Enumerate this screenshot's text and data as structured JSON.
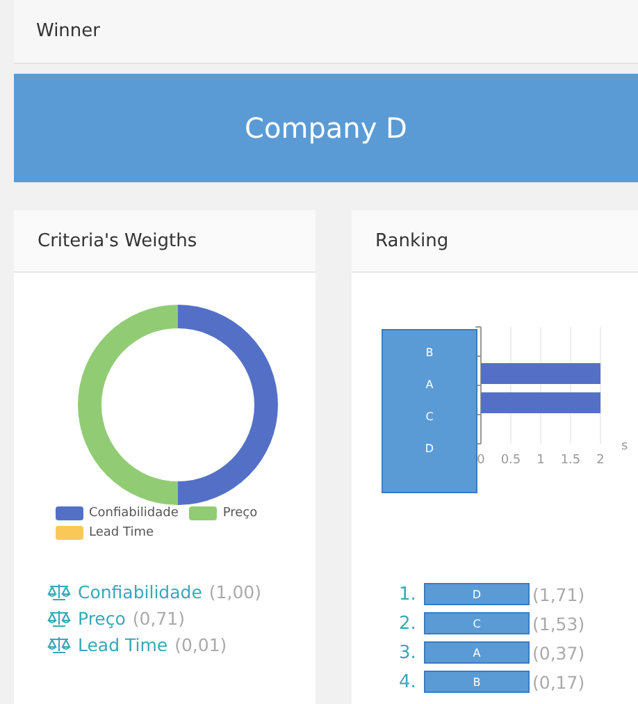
{
  "winner": {
    "title": "Winner",
    "company": "Company D"
  },
  "criteria": {
    "title": "Criteria's Weigths",
    "chart_data": {
      "type": "donut",
      "categories": [
        "Confiabilidade",
        "Preço",
        "Lead Time"
      ],
      "values": [
        0.5,
        0.5,
        0
      ]
    },
    "legend": [
      {
        "color": "#5470c6"
      },
      {
        "color": "#91cc75"
      },
      {
        "color": "#fac858"
      }
    ],
    "items": [
      {
        "name": "Confiabilidade",
        "value": "(1,00)"
      },
      {
        "name": "Preço",
        "value": "(0,71)"
      },
      {
        "name": "Lead Time",
        "value": "(0,01)"
      }
    ]
  },
  "ranking": {
    "title": "Ranking",
    "chart_data": {
      "type": "bar",
      "orientation": "horizontal",
      "categories": [
        "B",
        "A",
        "C",
        "D"
      ],
      "xlabel": "s",
      "xticks": [
        0,
        0.5,
        1,
        1.5,
        2
      ],
      "xlim": [
        0,
        2
      ],
      "grid": true,
      "series": [
        {
          "color": "#5470c6",
          "values": [
            null,
            2,
            2,
            null
          ]
        }
      ]
    },
    "items": [
      {
        "rank": "1.",
        "label": "D",
        "value": "(1,71)"
      },
      {
        "rank": "2.",
        "label": "C",
        "value": "(1,53)"
      },
      {
        "rank": "3.",
        "label": "A",
        "value": "(0,37)"
      },
      {
        "rank": "4.",
        "label": "B",
        "value": "(0,17)"
      }
    ]
  }
}
